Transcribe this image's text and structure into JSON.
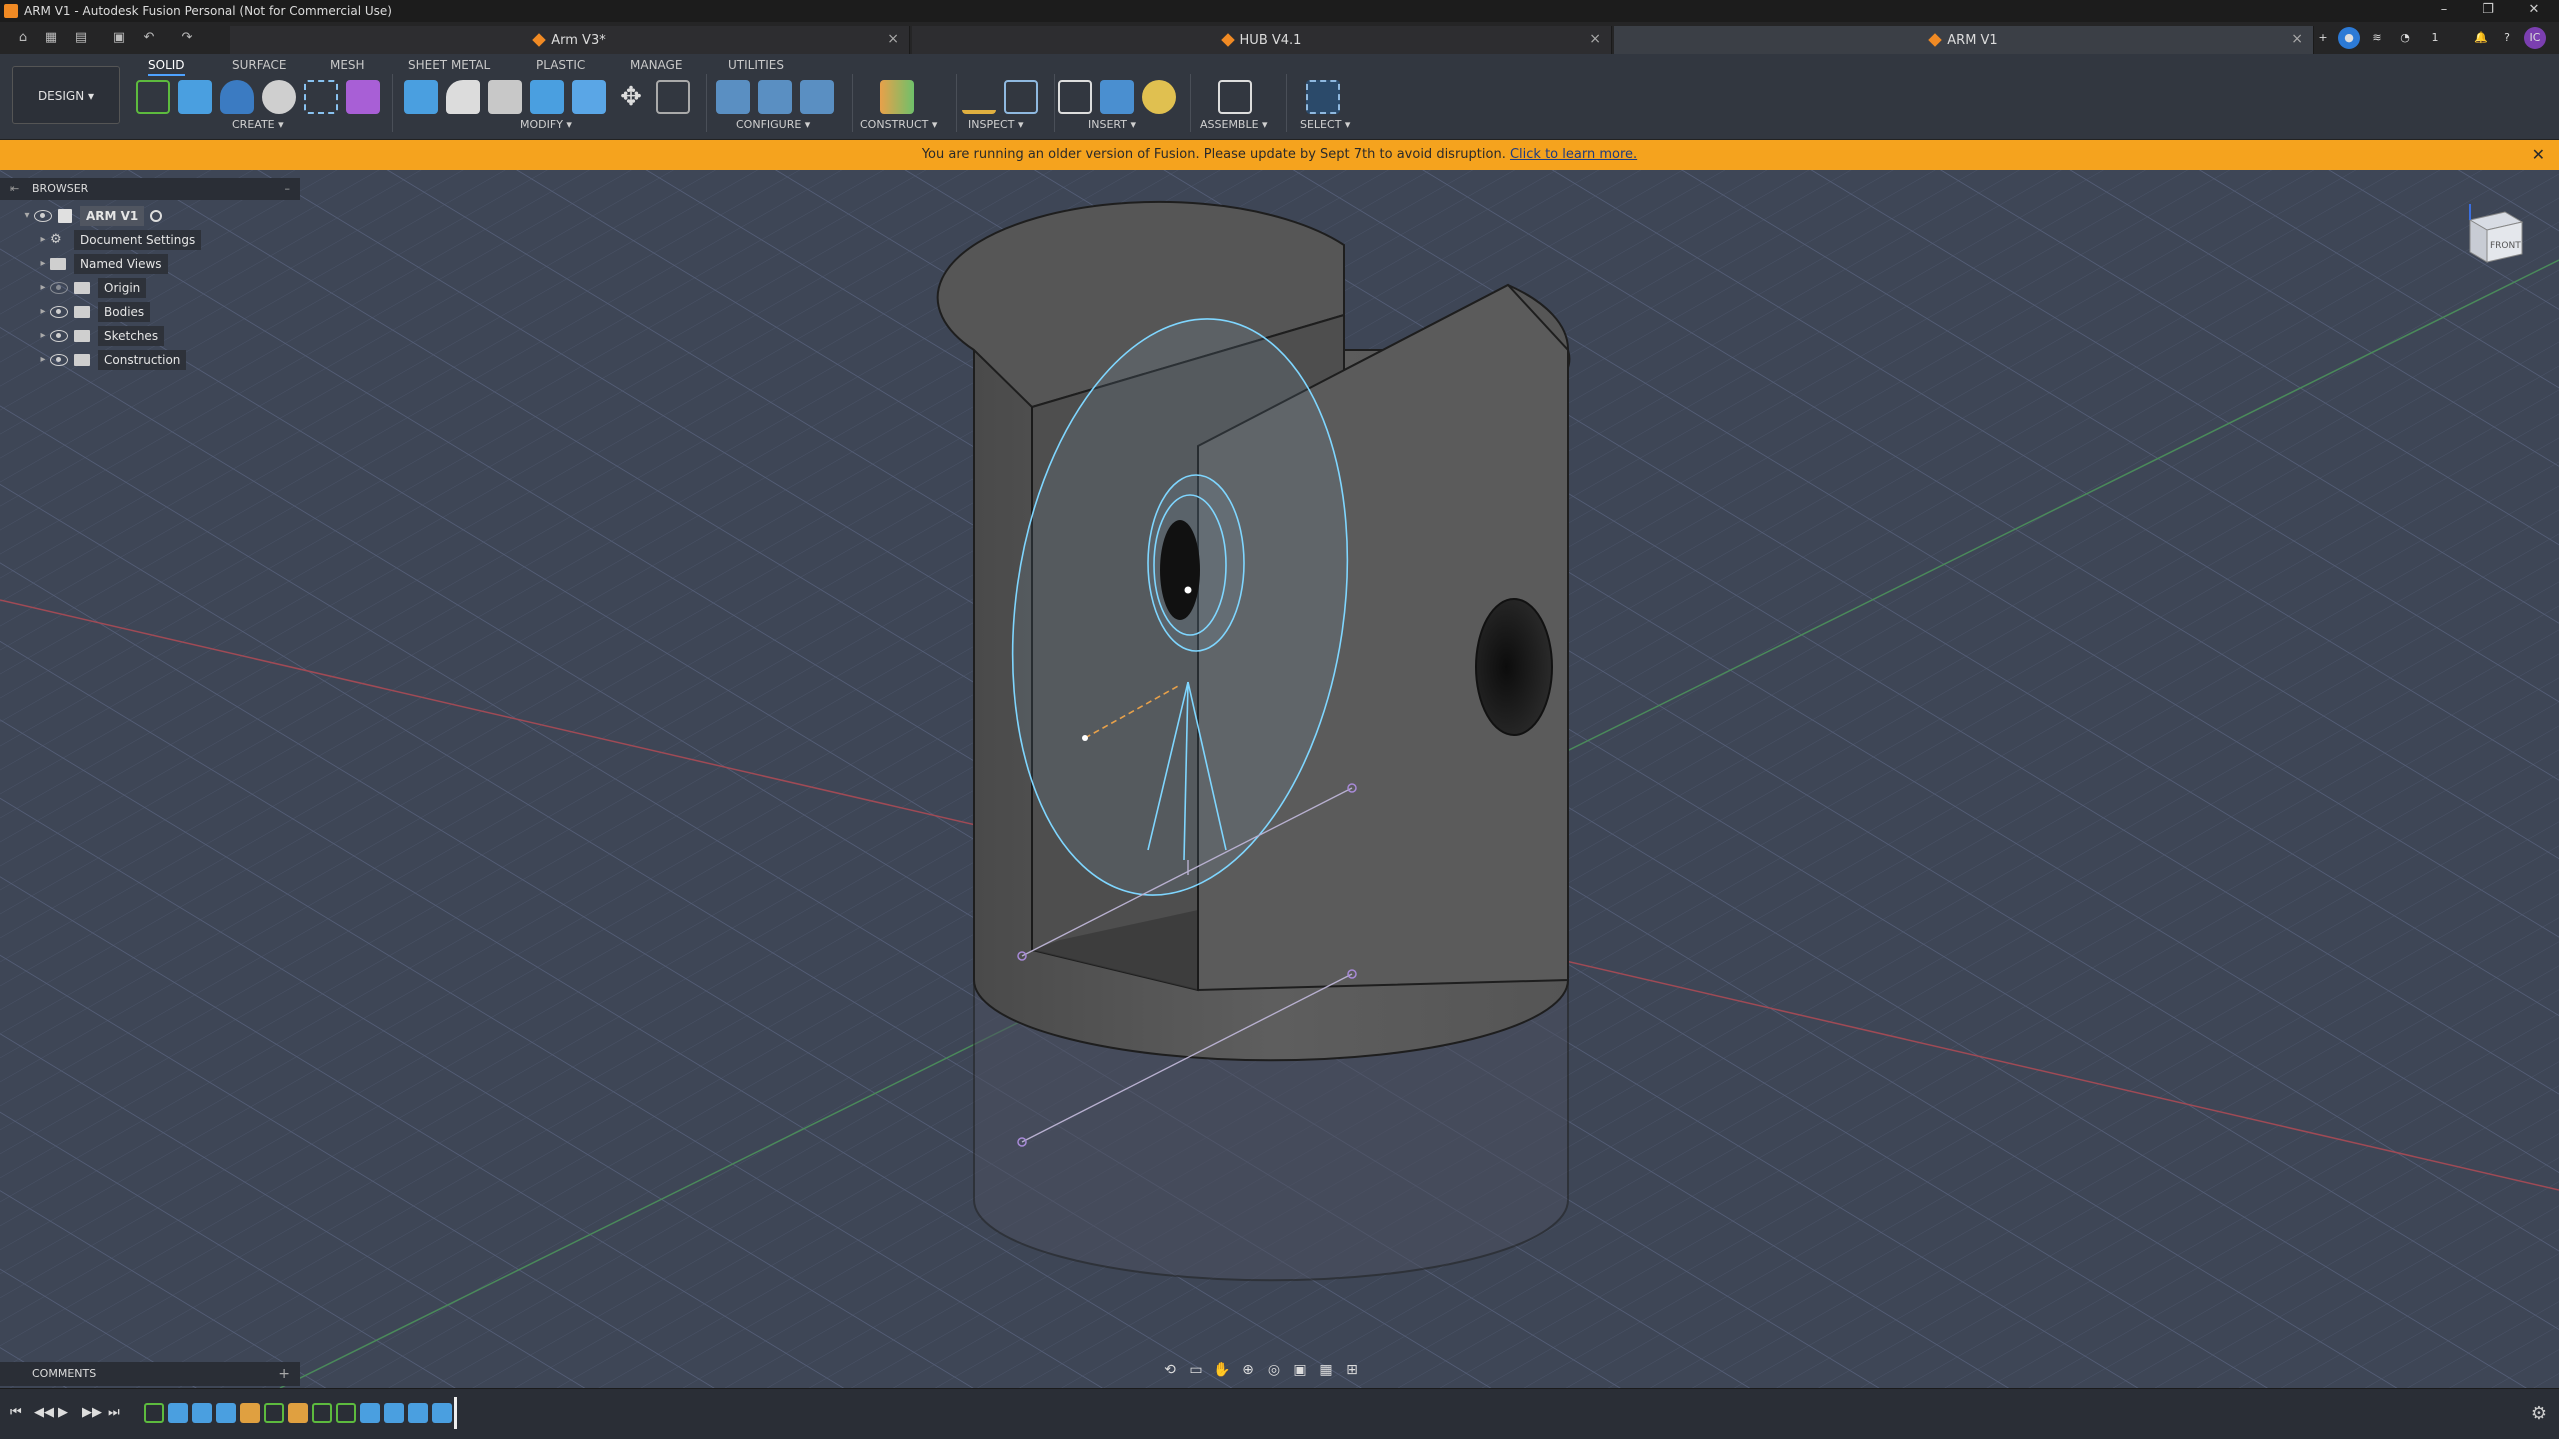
{
  "window": {
    "title": "ARM V1 - Autodesk Fusion Personal (Not for Commercial Use)"
  },
  "tabs": [
    {
      "label": "Arm V3*",
      "active": false
    },
    {
      "label": "HUB V4.1",
      "active": false
    },
    {
      "label": "ARM V1",
      "active": true
    }
  ],
  "header_right": {
    "job_count": "1",
    "user_initials": "IC"
  },
  "toolbar": {
    "workspace": "DESIGN",
    "tabs": [
      "SOLID",
      "SURFACE",
      "MESH",
      "SHEET METAL",
      "PLASTIC",
      "MANAGE",
      "UTILITIES"
    ],
    "groups": [
      "CREATE",
      "MODIFY",
      "CONFIGURE",
      "CONSTRUCT",
      "INSPECT",
      "INSERT",
      "ASSEMBLE",
      "SELECT"
    ]
  },
  "banner": {
    "message": "You are running an older version of Fusion. Please update by Sept 7th to avoid disruption.",
    "link": "Click to learn more."
  },
  "browser": {
    "title": "BROWSER",
    "root": "ARM V1",
    "items": [
      "Document Settings",
      "Named Views",
      "Origin",
      "Bodies",
      "Sketches",
      "Construction"
    ]
  },
  "comments": {
    "title": "COMMENTS"
  },
  "viewcube": {
    "face": "FRONT"
  },
  "colors": {
    "accent": "#f5a31e",
    "viewport_bg": "#3e4656",
    "body_fill": "#5a5a5a",
    "sketch_line": "#7fd6ff"
  }
}
